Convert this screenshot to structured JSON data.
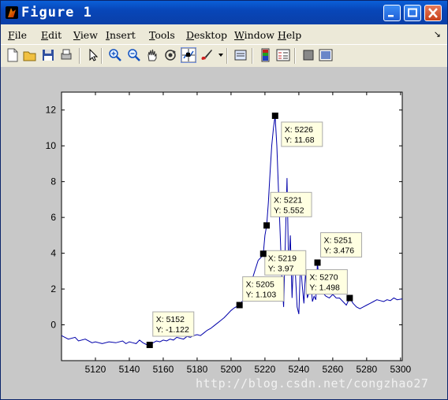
{
  "window": {
    "title": "Figure 1",
    "title_color": "#0a5fd8"
  },
  "menubar": {
    "items": [
      {
        "label": "File",
        "u": "F",
        "rest": "ile"
      },
      {
        "label": "Edit",
        "u": "E",
        "rest": "dit"
      },
      {
        "label": "View",
        "u": "V",
        "rest": "iew"
      },
      {
        "label": "Insert",
        "u": "I",
        "rest": "nsert"
      },
      {
        "label": "Tools",
        "u": "T",
        "rest": "ools"
      },
      {
        "label": "Desktop",
        "u": "D",
        "rest": "esktop"
      },
      {
        "label": "Window",
        "u": "W",
        "rest": "indow"
      },
      {
        "label": "Help",
        "u": "H",
        "rest": "elp"
      }
    ]
  },
  "toolbar": {
    "tools": [
      "new-figure-icon",
      "open-file-icon",
      "save-icon",
      "print-icon",
      "select-arrow-icon",
      "zoom-in-icon",
      "zoom-out-icon",
      "pan-hand-icon",
      "rotate-3d-icon",
      "data-cursor-icon",
      "brush-icon",
      "brush-dropdown-icon",
      "link-plot-icon",
      "insert-colorbar-icon",
      "insert-legend-icon",
      "hide-plot-tools-icon",
      "show-plot-tools-icon"
    ]
  },
  "chart_data": {
    "type": "line",
    "title": "",
    "xlabel": "",
    "ylabel": "",
    "xlim": [
      5100,
      5301
    ],
    "ylim": [
      -2,
      13
    ],
    "xticks": [
      "5120",
      "5140",
      "5160",
      "5180",
      "5200",
      "5220",
      "5240",
      "5260",
      "5280",
      "5300"
    ],
    "yticks": [
      "0",
      "2",
      "4",
      "6",
      "8",
      "10",
      "12"
    ],
    "line_color": "#0000aa",
    "series": [
      {
        "x": [
          5100,
          5104,
          5108,
          5110,
          5114,
          5118,
          5120,
          5124,
          5128,
          5132,
          5136,
          5138,
          5140,
          5142,
          5144,
          5146,
          5148,
          5150,
          5152,
          5154,
          5156,
          5158,
          5160,
          5162,
          5164,
          5166,
          5168,
          5170,
          5172,
          5174,
          5176,
          5178,
          5180,
          5182,
          5184,
          5186,
          5188,
          5190,
          5192,
          5194,
          5196,
          5198,
          5200,
          5202,
          5205,
          5208,
          5210,
          5212,
          5214,
          5216,
          5217,
          5218,
          5219,
          5220,
          5221,
          5222,
          5223,
          5224,
          5225,
          5226,
          5227,
          5228,
          5229,
          5230,
          5231,
          5232,
          5233,
          5234,
          5235,
          5236,
          5237,
          5238,
          5239,
          5240,
          5241,
          5242,
          5243,
          5244,
          5245,
          5246,
          5247,
          5248,
          5249,
          5250,
          5251,
          5252,
          5254,
          5256,
          5258,
          5260,
          5262,
          5264,
          5266,
          5268,
          5270,
          5272,
          5274,
          5276,
          5278,
          5280,
          5282,
          5284,
          5286,
          5288,
          5290,
          5292,
          5294,
          5296,
          5298,
          5301
        ],
        "y": [
          -0.6,
          -0.8,
          -0.7,
          -0.9,
          -0.8,
          -1.0,
          -0.95,
          -1.05,
          -0.95,
          -1.0,
          -0.9,
          -1.05,
          -0.95,
          -1.0,
          -1.05,
          -0.85,
          -1.0,
          -1.1,
          -1.12,
          -1.0,
          -0.9,
          -0.95,
          -0.85,
          -0.9,
          -0.8,
          -0.85,
          -0.7,
          -0.75,
          -0.8,
          -0.65,
          -0.7,
          -0.6,
          -0.55,
          -0.6,
          -0.45,
          -0.3,
          -0.2,
          -0.05,
          0.1,
          0.25,
          0.4,
          0.6,
          0.8,
          0.95,
          1.1,
          1.5,
          2.0,
          2.4,
          3.0,
          3.6,
          3.7,
          3.8,
          3.97,
          5.0,
          5.55,
          6.8,
          8.5,
          10.0,
          11.0,
          11.68,
          10.0,
          7.5,
          5.0,
          2.5,
          1.0,
          4.5,
          8.2,
          3.0,
          5.0,
          1.5,
          4.0,
          2.8,
          1.0,
          0.6,
          3.5,
          2.2,
          1.2,
          3.0,
          1.5,
          1.8,
          2.5,
          1.3,
          1.6,
          1.4,
          3.476,
          2.3,
          1.8,
          1.6,
          1.5,
          1.7,
          1.5,
          1.498,
          1.3,
          1.1,
          1.5,
          1.2,
          1.0,
          0.9,
          1.0,
          1.1,
          1.2,
          1.3,
          1.4,
          1.35,
          1.3,
          1.4,
          1.35,
          1.5,
          1.4,
          1.45
        ]
      }
    ],
    "datatips": [
      {
        "x": 5226,
        "y": 11.68,
        "line1": "X: 5226",
        "line2": "Y: 11.68"
      },
      {
        "x": 5221,
        "y": 5.552,
        "line1": "X: 5221",
        "line2": "Y: 5.552"
      },
      {
        "x": 5219,
        "y": 3.97,
        "line1": "X: 5219",
        "line2": "Y: 3.97"
      },
      {
        "x": 5251,
        "y": 3.476,
        "line1": "X: 5251",
        "line2": "Y: 3.476"
      },
      {
        "x": 5270,
        "y": 1.498,
        "line1": "X: 5270",
        "line2": "Y: 1.498"
      },
      {
        "x": 5205,
        "y": 1.103,
        "line1": "X: 5205",
        "line2": "Y: 1.103"
      },
      {
        "x": 5152,
        "y": -1.122,
        "line1": "X: 5152",
        "line2": "Y: -1.122"
      }
    ]
  },
  "watermark": "http://blog.csdn.net/congzhao27"
}
